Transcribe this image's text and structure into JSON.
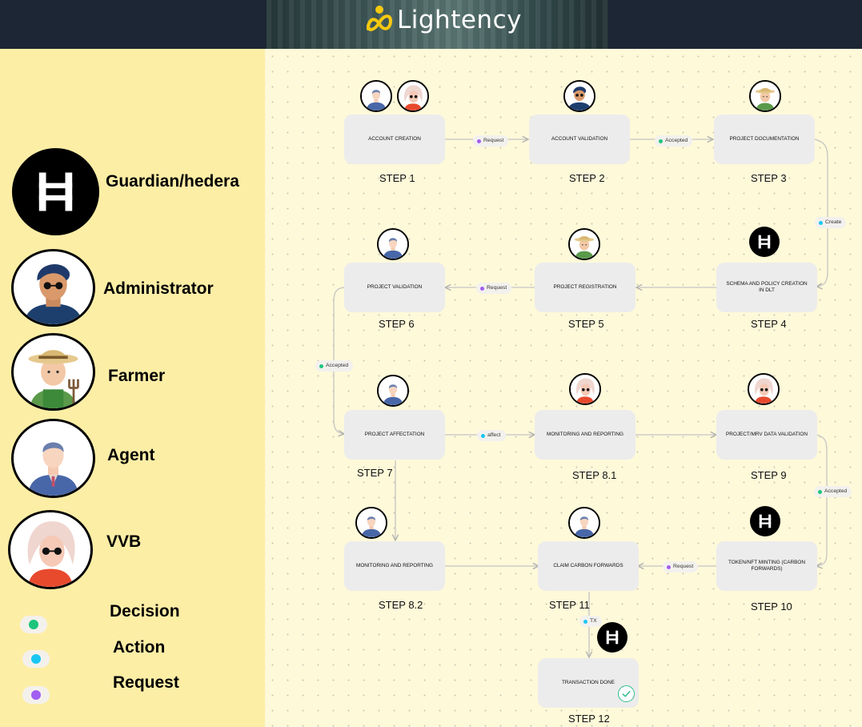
{
  "header": {
    "logo_text": "Lightency"
  },
  "legend": {
    "roles": [
      {
        "label": "Guardian/hedera",
        "icon": "hedera-icon"
      },
      {
        "label": "Administrator",
        "icon": "administrator-avatar-icon"
      },
      {
        "label": "Farmer",
        "icon": "farmer-avatar-icon"
      },
      {
        "label": "Agent",
        "icon": "agent-avatar-icon"
      },
      {
        "label": "VVB",
        "icon": "vvb-avatar-icon"
      }
    ],
    "edge_types": [
      {
        "label": "Decision",
        "color": "#1dc47c"
      },
      {
        "label": "Action",
        "color": "#19c6f2"
      },
      {
        "label": "Request",
        "color": "#a25ef0"
      }
    ]
  },
  "flow": {
    "nodes": [
      {
        "id": "n1",
        "label": "ACCOUNT CREATION",
        "step": "STEP 1"
      },
      {
        "id": "n2",
        "label": "ACCOUNT VALIDATION",
        "step": "STEP 2"
      },
      {
        "id": "n3",
        "label": "PROJECT DOCUMENTATION",
        "step": "STEP 3"
      },
      {
        "id": "n4",
        "label": "SCHEMA AND POLICY CREATION IN DLT",
        "step": "STEP 4"
      },
      {
        "id": "n5",
        "label": "PROJECT REGISTRATION",
        "step": "STEP 5"
      },
      {
        "id": "n6",
        "label": "PROJECT VALIDATION",
        "step": "STEP 6"
      },
      {
        "id": "n7",
        "label": "PROJECT AFFECTATION",
        "step": "STEP 7"
      },
      {
        "id": "n81",
        "label": "MONITORING AND REPORTING",
        "step": "STEP 8.1"
      },
      {
        "id": "n9",
        "label": "PROJECT/MRV DATA VALIDATION",
        "step": "STEP 9"
      },
      {
        "id": "n82",
        "label": "MONITORING AND REPORTING",
        "step": "STEP 8.2"
      },
      {
        "id": "n11",
        "label": "CLAIM CARBON FORWARDS",
        "step": "STEP 11"
      },
      {
        "id": "n10",
        "label": "TOKEN/NFT MINTING (CARBON FORWARDS)",
        "step": "STEP 10"
      },
      {
        "id": "n12",
        "label": "TRANSACTION DONE",
        "step": "STEP 12"
      }
    ],
    "edges": [
      {
        "from": "n1",
        "to": "n2",
        "label": "Request",
        "type": "Request",
        "color": "#a25ef0"
      },
      {
        "from": "n2",
        "to": "n3",
        "label": "Accepted",
        "type": "Decision",
        "color": "#1dc47c"
      },
      {
        "from": "n3",
        "to": "n4",
        "label": "Create",
        "type": "Action",
        "color": "#19c6f2"
      },
      {
        "from": "n4",
        "to": "n5",
        "label": ""
      },
      {
        "from": "n5",
        "to": "n6",
        "label": "Request",
        "type": "Request",
        "color": "#a25ef0"
      },
      {
        "from": "n6",
        "to": "n7",
        "label": "Accepted",
        "type": "Decision",
        "color": "#1dc47c"
      },
      {
        "from": "n7",
        "to": "n81",
        "label": "affect",
        "type": "Action",
        "color": "#19c6f2"
      },
      {
        "from": "n81",
        "to": "n9",
        "label": ""
      },
      {
        "from": "n9",
        "to": "n10",
        "label": "Accepted",
        "type": "Decision",
        "color": "#1dc47c"
      },
      {
        "from": "n7",
        "to": "n82",
        "label": ""
      },
      {
        "from": "n82",
        "to": "n11",
        "label": ""
      },
      {
        "from": "n10",
        "to": "n11",
        "label": "Request",
        "type": "Request",
        "color": "#a25ef0"
      },
      {
        "from": "n11",
        "to": "n12",
        "label": "TX",
        "type": "Action",
        "color": "#19c6f2"
      }
    ]
  }
}
